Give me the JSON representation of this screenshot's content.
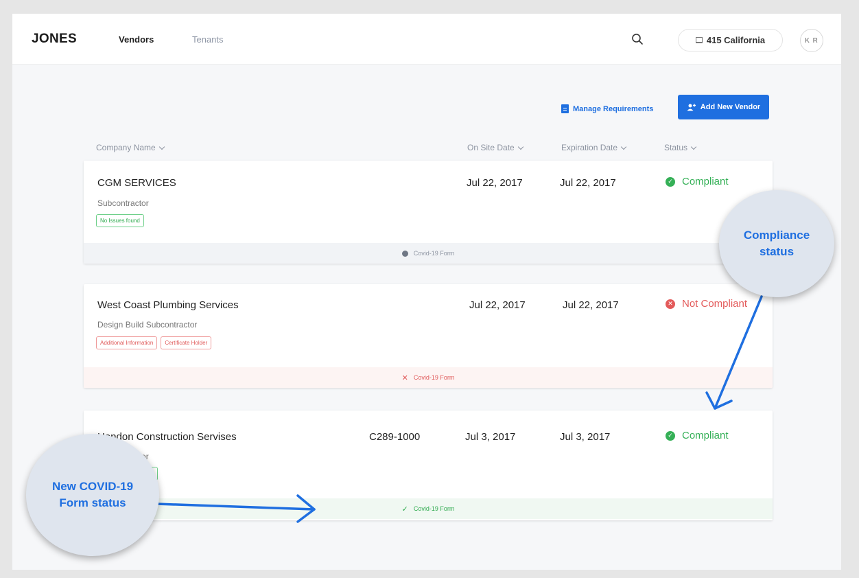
{
  "header": {
    "logo": "JONES",
    "nav": [
      "Vendors",
      "Tenants"
    ],
    "property": "415 California",
    "avatar_initials": "K R"
  },
  "actions": {
    "manage_label": "Manage Requirements",
    "add_label": "Add New Vendor"
  },
  "table": {
    "columns": [
      "Company Name",
      "On Site Date",
      "Expiration Date",
      "Status"
    ],
    "rows": [
      {
        "name": "CGM SERVICES",
        "type": "Subcontractor",
        "tags": [
          "No Issues found"
        ],
        "code": "",
        "on_site": "Jul 22, 2017",
        "expiration": "Jul 22, 2017",
        "status": "Compliant",
        "footer": "Covid-19 Form"
      },
      {
        "name": "West Coast Plumbing Services",
        "type": "Design Build Subcontractor",
        "tags": [
          "Additional Information",
          "Certificate Holder"
        ],
        "code": "",
        "on_site": "Jul 22, 2017",
        "expiration": "Jul 22, 2017",
        "status": "Not Compliant",
        "footer": "Covid-19 Form"
      },
      {
        "name": "Hendon Construction Servises",
        "type": "Subcontractor",
        "tags": [],
        "code": "C289-1000",
        "on_site": "Jul 3, 2017",
        "expiration": "Jul 3, 2017",
        "status": "Compliant",
        "footer": "Covid-19 Form"
      }
    ]
  },
  "callouts": {
    "compliance": [
      "Compliance",
      "status"
    ],
    "covid": [
      "New COVID-19",
      "Form status"
    ]
  },
  "colors": {
    "accent": "#1f6fe0",
    "compliant": "#35b057",
    "not_compliant": "#e35a5a"
  }
}
